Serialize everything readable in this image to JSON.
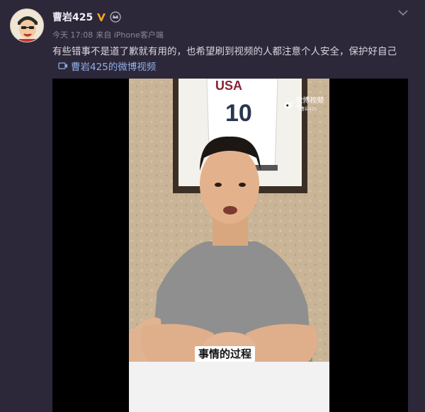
{
  "post": {
    "author": "曹岩425",
    "meta": {
      "time": "今天 17:08",
      "source": "来自 iPhone客户端"
    },
    "text": "有些错事不是道了歉就有用的，也希望刷到视频的人都注意个人安全，保护好自己",
    "video_link": "曹岩425的微博视频"
  },
  "video": {
    "watermark": "微博视频号",
    "watermark_sub": "@曹岩425",
    "subtitle": "事情的过程"
  },
  "icons": {
    "verified": "v-verified-icon",
    "crown": "crown-icon",
    "more": "chevron-down-icon",
    "video": "video-icon"
  },
  "colors": {
    "background": "#2c2739",
    "link": "#8fb1ea",
    "verified": "#f5a623"
  }
}
